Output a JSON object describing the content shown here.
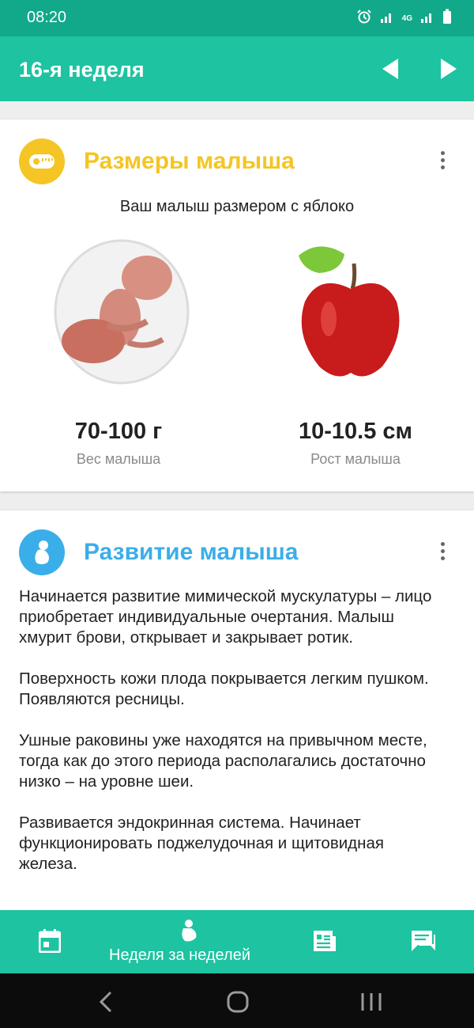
{
  "status_bar": {
    "time": "08:20",
    "network": "4G"
  },
  "app_bar": {
    "title": "16-я неделя"
  },
  "size_card": {
    "title": "Размеры малыша",
    "title_color": "#f4c524",
    "icon": "measuring-tape-icon",
    "subtitle": "Ваш малыш размером с яблоко",
    "weight": {
      "value": "70-100 г",
      "label": "Вес малыша"
    },
    "height": {
      "value": "10-10.5 см",
      "label": "Рост малыша"
    }
  },
  "development_card": {
    "title": "Развитие малыша",
    "title_color": "#3aaee8",
    "icon": "fetus-icon",
    "paragraphs": [
      "Начинается развитие мимической мускулатуры – лицо приобретает индивидуальные очертания. Малыш хмурит брови, открывает и закрывает ротик.",
      "Поверхность кожи плода покрывается легким пушком. Появляются ресницы.",
      "Ушные раковины уже находятся на привычном месте, тогда как до этого периода располагались достаточно низко – на уровне шеи.",
      "Развивается эндокринная система. Начинает функционировать поджелудочная и щитовидная железа."
    ]
  },
  "bottom_nav": {
    "active_label": "Неделя за неделей",
    "tabs": [
      "calendar-icon",
      "baby-footprint-icon",
      "articles-icon",
      "chat-icon"
    ]
  },
  "colors": {
    "primary": "#1ec3a1",
    "status_bar": "#11a98a"
  }
}
